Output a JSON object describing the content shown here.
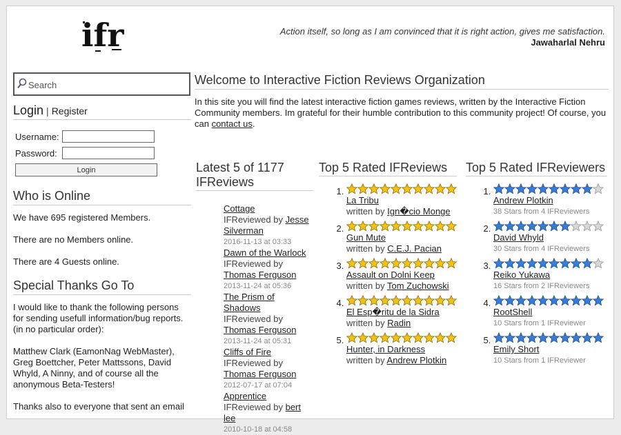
{
  "header": {
    "logo_text": "ifr",
    "quote": "Action itself, so long as I am convinced that it is right action, gives me satisfaction.",
    "quote_author": "Jawaharlal Nehru"
  },
  "sidebar": {
    "search": {
      "placeholder": "Search"
    },
    "login": {
      "title": "Login",
      "separator": "|",
      "register": "Register",
      "username_label": "Username:",
      "password_label": "Password:",
      "button": "Login"
    },
    "online": {
      "title": "Who is Online",
      "members": "We have 695 registered Members.",
      "none_online": "There are no Members online.",
      "guests": "There are 4 Guests online."
    },
    "thanks": {
      "title": "Special Thanks Go To",
      "p1": "I would like to thank the following persons for sending usefull information/bug reports. (in no particular order):",
      "p2": "Matthew Clark (EamonNag WebMaster), Greg Boettcher, Peter Mattssons, David Whyld, A Ninny, and of course all the anonymous Beta-Testers!",
      "p3": "Thanks also to everyone that sent an email"
    }
  },
  "main": {
    "title": "Welcome to Interactive Fiction Reviews Organization",
    "intro": "In this site you will find the latest interactive fiction games reviews, written by the Interactive Fiction Community members. Im grateful for their humble contribution to this community project! Of course, you can ",
    "contact": "contact us",
    "intro_end": "."
  },
  "latest": {
    "title": "Latest 5 of 1177 IFReviews",
    "by_label": "IFReviewed by ",
    "items": [
      {
        "game": "Cottage",
        "reviewer": "Jesse Silverman",
        "date": "2016-11-13 at 03:33"
      },
      {
        "game": "Dawn of the Warlock",
        "reviewer": "Thomas Ferguson",
        "date": "2013-11-24 at 05:36"
      },
      {
        "game": "The Prism of Shadows",
        "reviewer": "Thomas Ferguson",
        "date": "2013-11-24 at 05:31"
      },
      {
        "game": "Cliffs of Fire",
        "reviewer": "Thomas Ferguson",
        "date": "2012-07-17 at 07:04"
      },
      {
        "game": "Apprentice",
        "reviewer": "bert lee",
        "date": "2010-10-18 at 04:58"
      }
    ]
  },
  "top_reviews": {
    "title": "Top 5 Rated IFReviews",
    "written_label": "written by ",
    "star_color": "#f2c21a",
    "items": [
      {
        "game": "La Tribu",
        "author": "Ign�cio Monge",
        "stars": 10
      },
      {
        "game": "Gun Mute",
        "author": "C.E.J. Pacian",
        "stars": 10
      },
      {
        "game": "Assault on Dolni Keep",
        "author": "Tom Zuchowski",
        "stars": 10
      },
      {
        "game": "El Esp�ritu de la Sidra",
        "author": "Radin",
        "stars": 10
      },
      {
        "game": "Hunter, in Darkness",
        "author": "Andrew Plotkin",
        "stars": 10
      }
    ]
  },
  "top_reviewers": {
    "title": "Top 5 Rated IFReviewers",
    "star_color": "#3a7bd5",
    "items": [
      {
        "name": "Andrew Plotkin",
        "info": "38 Stars from 4 IFReviewers",
        "stars": 9
      },
      {
        "name": "David Whyld",
        "info": "30 Stars from 4 IFReviewers",
        "stars": 7
      },
      {
        "name": "Reiko Yukawa",
        "info": "16 Stars from 2 IFReviewers",
        "stars": 9
      },
      {
        "name": "RootShell",
        "info": "10 Stars from 1 IFReviewer",
        "stars": 10
      },
      {
        "name": "Emily Short",
        "info": "10 Stars from 1 IFReviewer",
        "stars": 10
      }
    ]
  }
}
